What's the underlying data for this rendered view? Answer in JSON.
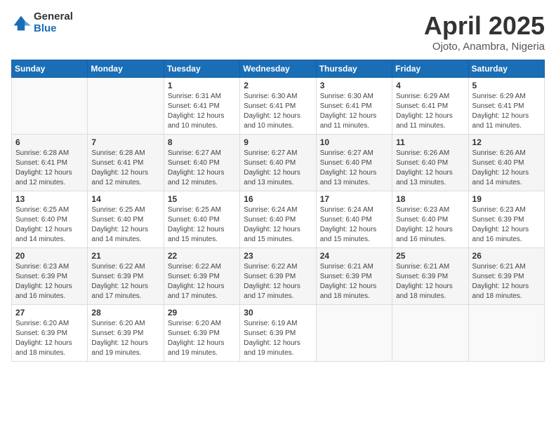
{
  "logo": {
    "general": "General",
    "blue": "Blue"
  },
  "title": {
    "month": "April 2025",
    "location": "Ojoto, Anambra, Nigeria"
  },
  "calendar": {
    "headers": [
      "Sunday",
      "Monday",
      "Tuesday",
      "Wednesday",
      "Thursday",
      "Friday",
      "Saturday"
    ],
    "weeks": [
      [
        {
          "day": "",
          "detail": ""
        },
        {
          "day": "",
          "detail": ""
        },
        {
          "day": "1",
          "detail": "Sunrise: 6:31 AM\nSunset: 6:41 PM\nDaylight: 12 hours\nand 10 minutes."
        },
        {
          "day": "2",
          "detail": "Sunrise: 6:30 AM\nSunset: 6:41 PM\nDaylight: 12 hours\nand 10 minutes."
        },
        {
          "day": "3",
          "detail": "Sunrise: 6:30 AM\nSunset: 6:41 PM\nDaylight: 12 hours\nand 11 minutes."
        },
        {
          "day": "4",
          "detail": "Sunrise: 6:29 AM\nSunset: 6:41 PM\nDaylight: 12 hours\nand 11 minutes."
        },
        {
          "day": "5",
          "detail": "Sunrise: 6:29 AM\nSunset: 6:41 PM\nDaylight: 12 hours\nand 11 minutes."
        }
      ],
      [
        {
          "day": "6",
          "detail": "Sunrise: 6:28 AM\nSunset: 6:41 PM\nDaylight: 12 hours\nand 12 minutes."
        },
        {
          "day": "7",
          "detail": "Sunrise: 6:28 AM\nSunset: 6:41 PM\nDaylight: 12 hours\nand 12 minutes."
        },
        {
          "day": "8",
          "detail": "Sunrise: 6:27 AM\nSunset: 6:40 PM\nDaylight: 12 hours\nand 12 minutes."
        },
        {
          "day": "9",
          "detail": "Sunrise: 6:27 AM\nSunset: 6:40 PM\nDaylight: 12 hours\nand 13 minutes."
        },
        {
          "day": "10",
          "detail": "Sunrise: 6:27 AM\nSunset: 6:40 PM\nDaylight: 12 hours\nand 13 minutes."
        },
        {
          "day": "11",
          "detail": "Sunrise: 6:26 AM\nSunset: 6:40 PM\nDaylight: 12 hours\nand 13 minutes."
        },
        {
          "day": "12",
          "detail": "Sunrise: 6:26 AM\nSunset: 6:40 PM\nDaylight: 12 hours\nand 14 minutes."
        }
      ],
      [
        {
          "day": "13",
          "detail": "Sunrise: 6:25 AM\nSunset: 6:40 PM\nDaylight: 12 hours\nand 14 minutes."
        },
        {
          "day": "14",
          "detail": "Sunrise: 6:25 AM\nSunset: 6:40 PM\nDaylight: 12 hours\nand 14 minutes."
        },
        {
          "day": "15",
          "detail": "Sunrise: 6:25 AM\nSunset: 6:40 PM\nDaylight: 12 hours\nand 15 minutes."
        },
        {
          "day": "16",
          "detail": "Sunrise: 6:24 AM\nSunset: 6:40 PM\nDaylight: 12 hours\nand 15 minutes."
        },
        {
          "day": "17",
          "detail": "Sunrise: 6:24 AM\nSunset: 6:40 PM\nDaylight: 12 hours\nand 15 minutes."
        },
        {
          "day": "18",
          "detail": "Sunrise: 6:23 AM\nSunset: 6:40 PM\nDaylight: 12 hours\nand 16 minutes."
        },
        {
          "day": "19",
          "detail": "Sunrise: 6:23 AM\nSunset: 6:39 PM\nDaylight: 12 hours\nand 16 minutes."
        }
      ],
      [
        {
          "day": "20",
          "detail": "Sunrise: 6:23 AM\nSunset: 6:39 PM\nDaylight: 12 hours\nand 16 minutes."
        },
        {
          "day": "21",
          "detail": "Sunrise: 6:22 AM\nSunset: 6:39 PM\nDaylight: 12 hours\nand 17 minutes."
        },
        {
          "day": "22",
          "detail": "Sunrise: 6:22 AM\nSunset: 6:39 PM\nDaylight: 12 hours\nand 17 minutes."
        },
        {
          "day": "23",
          "detail": "Sunrise: 6:22 AM\nSunset: 6:39 PM\nDaylight: 12 hours\nand 17 minutes."
        },
        {
          "day": "24",
          "detail": "Sunrise: 6:21 AM\nSunset: 6:39 PM\nDaylight: 12 hours\nand 18 minutes."
        },
        {
          "day": "25",
          "detail": "Sunrise: 6:21 AM\nSunset: 6:39 PM\nDaylight: 12 hours\nand 18 minutes."
        },
        {
          "day": "26",
          "detail": "Sunrise: 6:21 AM\nSunset: 6:39 PM\nDaylight: 12 hours\nand 18 minutes."
        }
      ],
      [
        {
          "day": "27",
          "detail": "Sunrise: 6:20 AM\nSunset: 6:39 PM\nDaylight: 12 hours\nand 18 minutes."
        },
        {
          "day": "28",
          "detail": "Sunrise: 6:20 AM\nSunset: 6:39 PM\nDaylight: 12 hours\nand 19 minutes."
        },
        {
          "day": "29",
          "detail": "Sunrise: 6:20 AM\nSunset: 6:39 PM\nDaylight: 12 hours\nand 19 minutes."
        },
        {
          "day": "30",
          "detail": "Sunrise: 6:19 AM\nSunset: 6:39 PM\nDaylight: 12 hours\nand 19 minutes."
        },
        {
          "day": "",
          "detail": ""
        },
        {
          "day": "",
          "detail": ""
        },
        {
          "day": "",
          "detail": ""
        }
      ]
    ]
  }
}
